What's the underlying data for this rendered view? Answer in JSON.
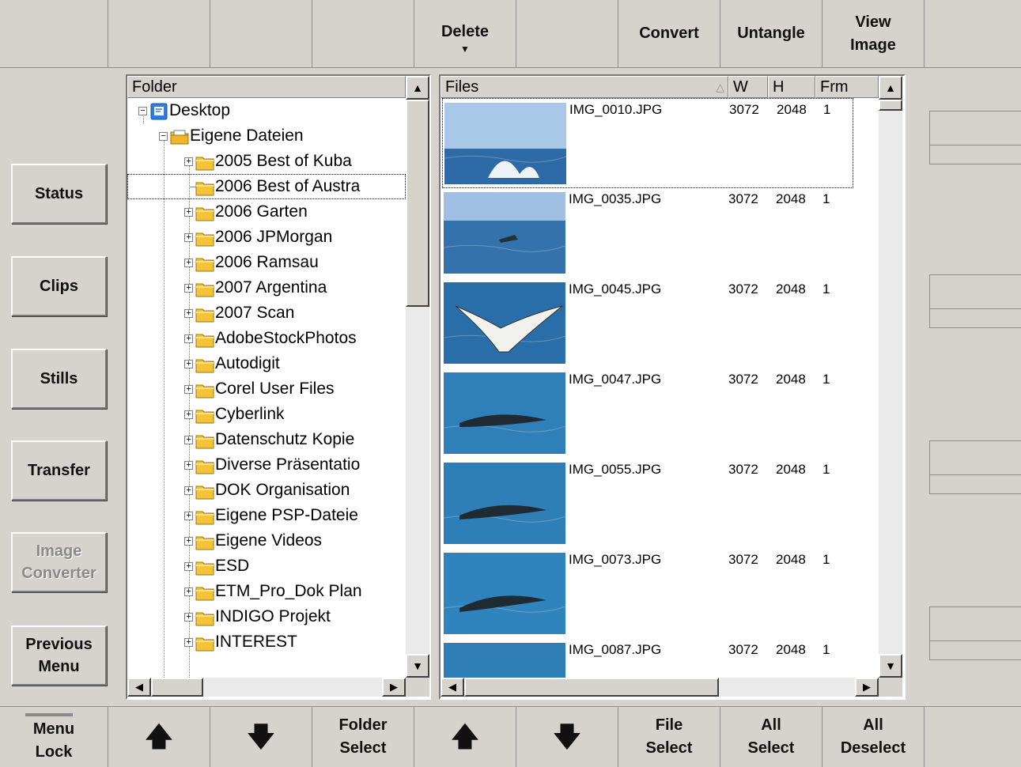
{
  "top_toolbar": {
    "buttons": [
      {
        "label": ""
      },
      {
        "label": ""
      },
      {
        "label": ""
      },
      {
        "label": ""
      },
      {
        "label": "Delete",
        "has_dropdown": true
      },
      {
        "label": ""
      },
      {
        "label": "Convert"
      },
      {
        "label": "Untangle"
      },
      {
        "label": "View\nImage"
      },
      {
        "label": ""
      }
    ]
  },
  "side_menu": {
    "status": "Status",
    "clips": "Clips",
    "stills": "Stills",
    "transfer": "Transfer",
    "image_converter": "Image\nConverter",
    "previous_menu": "Previous\nMenu"
  },
  "folder_panel": {
    "header": "Folder",
    "tree": [
      {
        "label": "Desktop",
        "level": 0,
        "icon": "desktop-icon",
        "expander": "minus"
      },
      {
        "label": "Eigene Dateien",
        "level": 1,
        "icon": "documents-folder-icon",
        "expander": "minus"
      },
      {
        "label": "2005 Best of Kuba",
        "level": 2,
        "icon": "folder-icon",
        "expander": "plus"
      },
      {
        "label": "2006 Best of Austra",
        "level": 2,
        "icon": "folder-icon",
        "expander": "none",
        "selected": true
      },
      {
        "label": "2006 Garten",
        "level": 2,
        "icon": "folder-icon",
        "expander": "plus"
      },
      {
        "label": "2006 JPMorgan",
        "level": 2,
        "icon": "folder-icon",
        "expander": "plus"
      },
      {
        "label": "2006 Ramsau",
        "level": 2,
        "icon": "folder-icon",
        "expander": "plus"
      },
      {
        "label": "2007 Argentina",
        "level": 2,
        "icon": "folder-icon",
        "expander": "plus"
      },
      {
        "label": "2007 Scan",
        "level": 2,
        "icon": "folder-icon",
        "expander": "plus"
      },
      {
        "label": "AdobeStockPhotos",
        "level": 2,
        "icon": "folder-icon",
        "expander": "plus"
      },
      {
        "label": "Autodigit",
        "level": 2,
        "icon": "folder-icon",
        "expander": "plus"
      },
      {
        "label": "Corel User Files",
        "level": 2,
        "icon": "folder-icon",
        "expander": "plus"
      },
      {
        "label": "Cyberlink",
        "level": 2,
        "icon": "folder-icon",
        "expander": "plus"
      },
      {
        "label": "Datenschutz Kopie",
        "level": 2,
        "icon": "folder-icon",
        "expander": "plus"
      },
      {
        "label": "Diverse Präsentatio",
        "level": 2,
        "icon": "folder-icon",
        "expander": "plus"
      },
      {
        "label": "DOK Organisation",
        "level": 2,
        "icon": "folder-icon",
        "expander": "plus"
      },
      {
        "label": "Eigene PSP-Dateie",
        "level": 2,
        "icon": "folder-icon",
        "expander": "plus"
      },
      {
        "label": "Eigene Videos",
        "level": 2,
        "icon": "folder-icon",
        "expander": "plus"
      },
      {
        "label": "ESD",
        "level": 2,
        "icon": "folder-icon",
        "expander": "plus"
      },
      {
        "label": "ETM_Pro_Dok Plan",
        "level": 2,
        "icon": "folder-icon",
        "expander": "plus"
      },
      {
        "label": "INDIGO Projekt",
        "level": 2,
        "icon": "folder-icon",
        "expander": "plus"
      },
      {
        "label": "INTEREST",
        "level": 2,
        "icon": "folder-icon",
        "expander": "plus"
      }
    ]
  },
  "files_panel": {
    "headers": {
      "files": "Files",
      "w": "W",
      "h": "H",
      "frm": "Frm"
    },
    "sort_indicator": "sort-ascending-icon",
    "files": [
      {
        "name": "IMG_0010.JPG",
        "w": "3072",
        "h": "2048",
        "frm": "1",
        "selected": true
      },
      {
        "name": "IMG_0035.JPG",
        "w": "3072",
        "h": "2048",
        "frm": "1"
      },
      {
        "name": "IMG_0045.JPG",
        "w": "3072",
        "h": "2048",
        "frm": "1"
      },
      {
        "name": "IMG_0047.JPG",
        "w": "3072",
        "h": "2048",
        "frm": "1"
      },
      {
        "name": "IMG_0055.JPG",
        "w": "3072",
        "h": "2048",
        "frm": "1"
      },
      {
        "name": "IMG_0073.JPG",
        "w": "3072",
        "h": "2048",
        "frm": "1"
      },
      {
        "name": "IMG_0087.JPG",
        "w": "3072",
        "h": "2048",
        "frm": "1"
      }
    ]
  },
  "bottom_toolbar": {
    "menu_lock": "Menu\nLock",
    "folder_up": "up-arrow-icon",
    "folder_down": "down-arrow-icon",
    "folder_select": "Folder\nSelect",
    "file_up": "up-arrow-icon",
    "file_down": "down-arrow-icon",
    "file_select": "File\nSelect",
    "all_select": "All\nSelect",
    "all_deselect": "All\nDeselect"
  },
  "colors": {
    "background": "#d6d3ce",
    "panel": "#ffffff",
    "folder_yellow": "#f5c23a"
  }
}
